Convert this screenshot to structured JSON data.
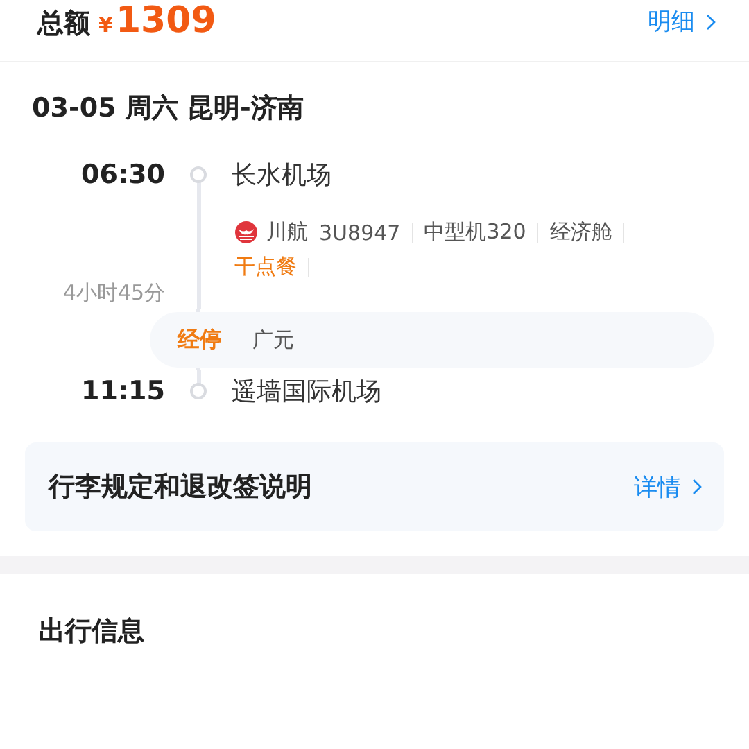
{
  "summary": {
    "label": "总额",
    "currency": "¥",
    "amount": "1309",
    "link": "明细"
  },
  "trip": {
    "title": "03-05 周六 昆明-济南"
  },
  "departure": {
    "time": "06:30",
    "airport": "长水机场"
  },
  "flight": {
    "airline": "川航",
    "number": "3U8947",
    "tags": [
      {
        "text": "中型机320",
        "kind": "plain"
      },
      {
        "text": "经济舱",
        "kind": "plain"
      },
      {
        "text": "干点餐",
        "kind": "highlight"
      }
    ]
  },
  "duration": "4小时45分",
  "stop": {
    "label": "经停",
    "city": "广元"
  },
  "arrival": {
    "time": "11:15",
    "airport": "遥墙国际机场"
  },
  "policy": {
    "title": "行李规定和退改签说明",
    "link": "详情"
  },
  "section": {
    "title": "出行信息"
  }
}
